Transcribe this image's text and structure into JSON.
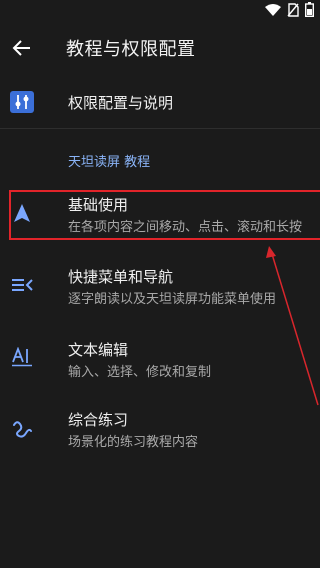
{
  "app_bar": {
    "title": "教程与权限配置"
  },
  "permissions_row": {
    "label": "权限配置与说明"
  },
  "section": {
    "label": "天坦读屏 教程"
  },
  "tutorials": [
    {
      "title": "基础使用",
      "subtitle": "在各项内容之间移动、点击、滚动和长按"
    },
    {
      "title": "快捷菜单和导航",
      "subtitle": "逐字朗读以及天坦读屏功能菜单使用"
    },
    {
      "title": "文本编辑",
      "subtitle": "输入、选择、修改和复制"
    },
    {
      "title": "综合练习",
      "subtitle": "场景化的练习教程内容"
    }
  ],
  "colors": {
    "background": "#1b1b1b",
    "accent": "#8ab4f8",
    "highlight": "#e2242a",
    "icon_blue": "#7aa7ff"
  }
}
